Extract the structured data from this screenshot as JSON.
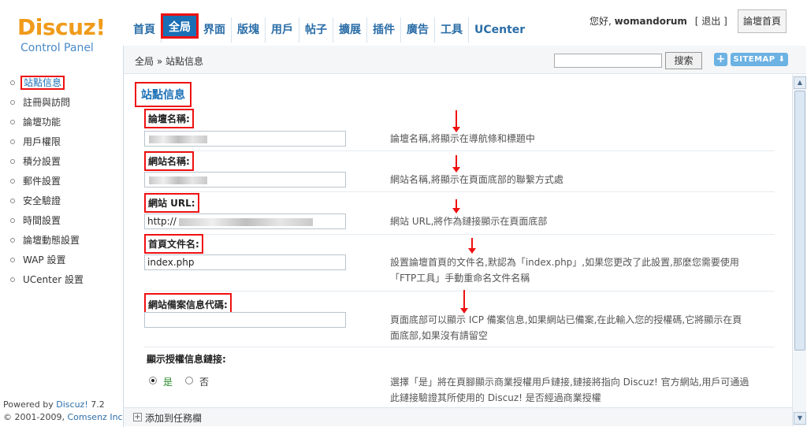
{
  "logo": {
    "main": "Discuz!",
    "sub": "Control Panel"
  },
  "nav": [
    {
      "label": "首頁"
    },
    {
      "label": "全局"
    },
    {
      "label": "界面"
    },
    {
      "label": "版塊"
    },
    {
      "label": "用戶"
    },
    {
      "label": "帖子"
    },
    {
      "label": "擴展"
    },
    {
      "label": "插件"
    },
    {
      "label": "廣告"
    },
    {
      "label": "工具"
    },
    {
      "label": "UCenter"
    }
  ],
  "user": {
    "greeting": "您好,",
    "name": "womandorum",
    "logout": "[ 退出 ]",
    "home_button": "論壇首頁"
  },
  "toolbar": {
    "breadcrumb": "全局 » 站點信息",
    "search_button": "搜索",
    "plus": "+",
    "sitemap": "SITEMAP ⬇"
  },
  "sidebar": {
    "items": [
      {
        "label": "站點信息"
      },
      {
        "label": "註冊與訪問"
      },
      {
        "label": "論壇功能"
      },
      {
        "label": "用戶權限"
      },
      {
        "label": "積分設置"
      },
      {
        "label": "郵件設置"
      },
      {
        "label": "安全驗證"
      },
      {
        "label": "時間設置"
      },
      {
        "label": "論壇動態設置"
      },
      {
        "label": "WAP 設置"
      },
      {
        "label": "UCenter 設置"
      }
    ],
    "powered_prefix": "Powered by",
    "powered_link": "Discuz!",
    "powered_version": "7.2",
    "copyright_prefix": "© 2001-2009,",
    "copyright_link": "Comsenz Inc."
  },
  "section": {
    "title": "站點信息"
  },
  "fields": {
    "bbname": {
      "label": "論壇名稱:",
      "desc": "論壇名稱,將顯示在導航條和標題中"
    },
    "sitename": {
      "label": "網站名稱:",
      "desc": "網站名稱,將顯示在頁面底部的聯繫方式處"
    },
    "siteurl": {
      "label": "網站 URL:",
      "value": "http://",
      "desc": "網站 URL,將作為鏈接顯示在頁面底部"
    },
    "indexname": {
      "label": "首頁文件名:",
      "value": "index.php",
      "desc1": "設置論壇首頁的文件名,默認為「index.php」,如果您更改了此設置,那麼您需要使用",
      "desc2": "「FTP工具」手動重命名文件名稱"
    },
    "icp": {
      "label": "網站備案信息代碼:",
      "desc1": "頁面底部可以顯示 ICP 備案信息,如果網站已備案,在此輸入您的授權碼,它將顯示在頁",
      "desc2": "面底部,如果沒有請留空"
    },
    "license": {
      "label": "顯示授權信息鏈接:",
      "yes": "是",
      "no": "否",
      "desc1": "選擇「是」將在頁腳顯示商業授權用戶鏈接,鏈接將指向 Discuz! 官方網站,用戶可通過",
      "desc2": "此鏈接驗證其所使用的 Discuz! 是否經過商業授權"
    }
  },
  "taskbar": {
    "icon": "+",
    "label": "添加到任務欄"
  },
  "colors": {
    "accent": "#1a6fb5",
    "highlight": "#ee1111",
    "logo": "#f09b1b"
  }
}
